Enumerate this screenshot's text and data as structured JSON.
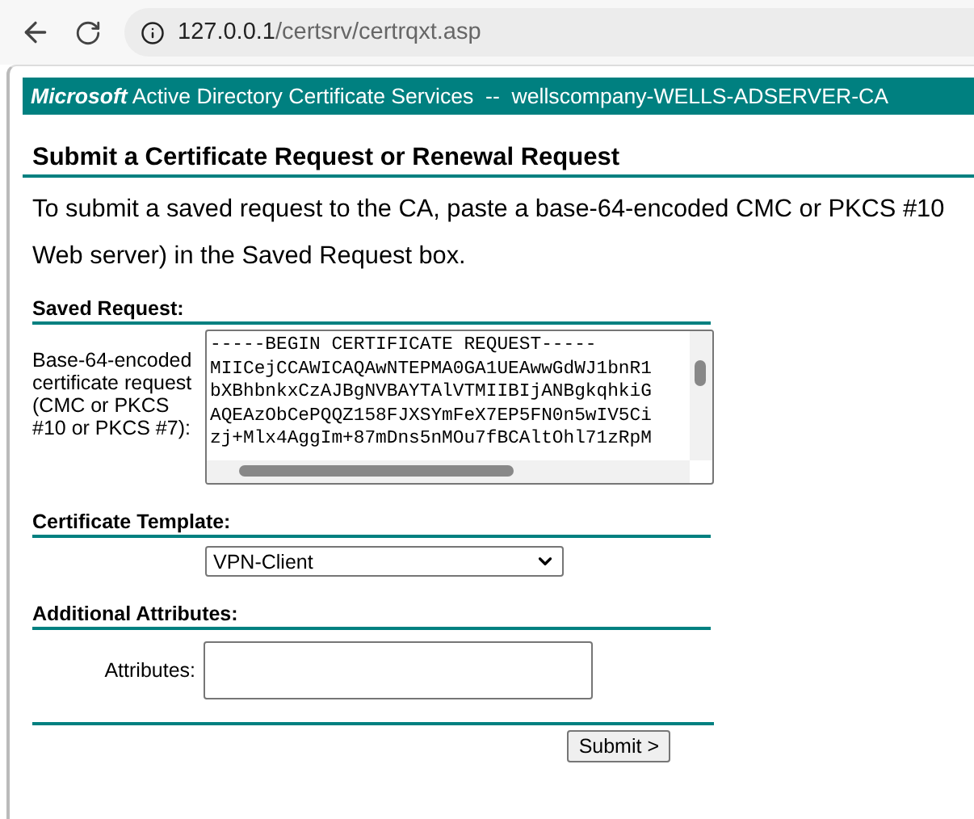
{
  "browser": {
    "url_host": "127.0.0.1",
    "url_path": "/certsrv/certrqxt.asp"
  },
  "banner": {
    "brand": "Microsoft",
    "title": "Active Directory Certificate Services  --  wellscompany-WELLS-ADSERVER-CA"
  },
  "heading": "Submit a Certificate Request or Renewal Request",
  "intro": [
    "To submit a saved request to the CA, paste a base-64-encoded CMC or PKCS #10",
    "Web server) in the Saved Request box."
  ],
  "saved_request": {
    "section": "Saved Request:",
    "label": "Base-64-encoded certificate request (CMC or PKCS #10 or PKCS #7):",
    "lines": [
      "-----BEGIN CERTIFICATE REQUEST-----",
      "MIICejCCAWICAQAwNTEPMA0GA1UEAwwGdWJ1bnR1",
      "bXBhbnkxCzAJBgNVBAYTAlVTMIIBIjANBgkqhkiG",
      "AQEAzObCePQQZ158FJXSYmFeX7EP5FN0n5wIV5Ci",
      "zj+Mlx4AggIm+87mDns5nMOu7fBCAltOhl71zRpM"
    ]
  },
  "template": {
    "section": "Certificate Template:",
    "value": "VPN-Client"
  },
  "attributes": {
    "section": "Additional Attributes:",
    "label": "Attributes:"
  },
  "submit": "Submit >"
}
